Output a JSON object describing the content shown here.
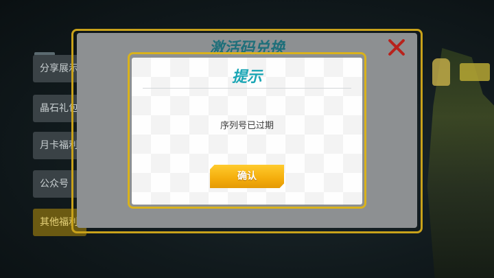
{
  "side_menu": {
    "items": [
      {
        "label": "分享展示",
        "icon": "share-icon"
      },
      {
        "label": "晶石礼包"
      },
      {
        "label": "月卡福利"
      },
      {
        "label": "公众号"
      },
      {
        "label": "其他福利"
      }
    ]
  },
  "redeem_panel": {
    "title": "激活码兑换",
    "close_icon": "close-icon"
  },
  "dialog": {
    "title": "提示",
    "message": "序列号已过期",
    "confirm_label": "确认"
  },
  "colors": {
    "accent_gold": "#d9b21c",
    "title_teal": "#1aa6b5",
    "close_red": "#b8221c",
    "button_yellow": "#f4ad0c"
  }
}
